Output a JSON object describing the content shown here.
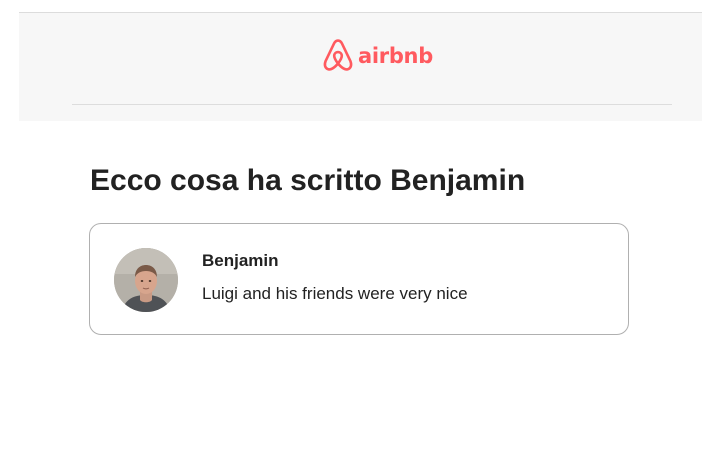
{
  "header": {
    "logo": {
      "icon": "airbnb-belo-icon",
      "text": "airbnb",
      "color": "#ff5a5f"
    }
  },
  "main": {
    "title": "Ecco cosa ha scritto Benjamin",
    "review": {
      "reviewer_name": "Benjamin",
      "text": "Luigi and his friends were very nice"
    }
  }
}
